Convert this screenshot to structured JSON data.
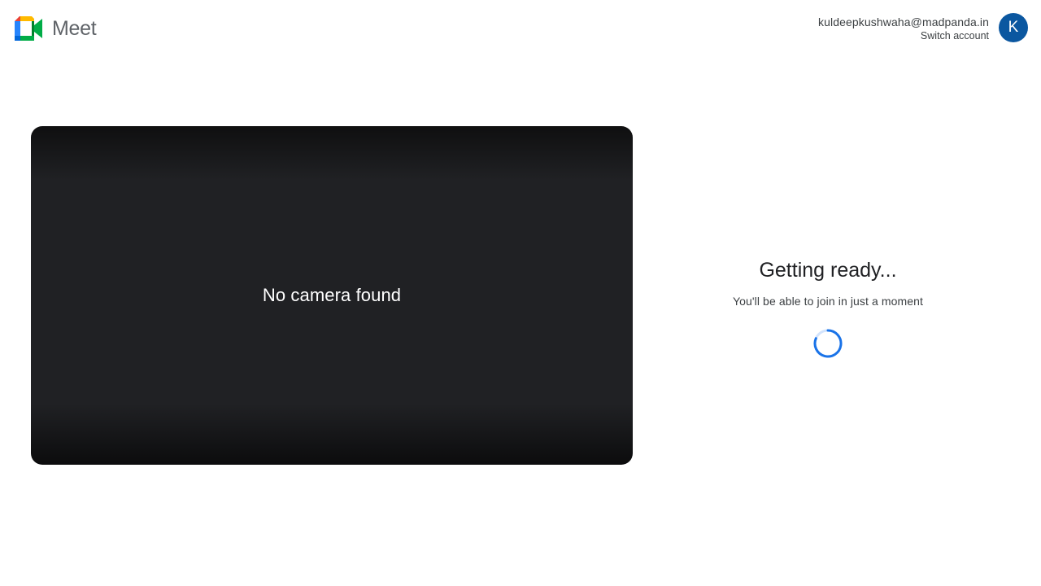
{
  "app": {
    "name": "Meet",
    "logo_icon": "google-meet-logo",
    "colors": {
      "blue": "#1a73e8",
      "green": "#00ac47",
      "yellow": "#ffba00",
      "red": "#ea4335",
      "avatar": "#0b57a0"
    }
  },
  "account": {
    "email": "kuldeepkushwaha@madpanda.in",
    "switch_label": "Switch account",
    "avatar_initial": "K"
  },
  "preview": {
    "message": "No camera found"
  },
  "status": {
    "title": "Getting ready...",
    "subtitle": "You'll be able to join in just a moment",
    "spinner_icon": "loading-spinner"
  }
}
